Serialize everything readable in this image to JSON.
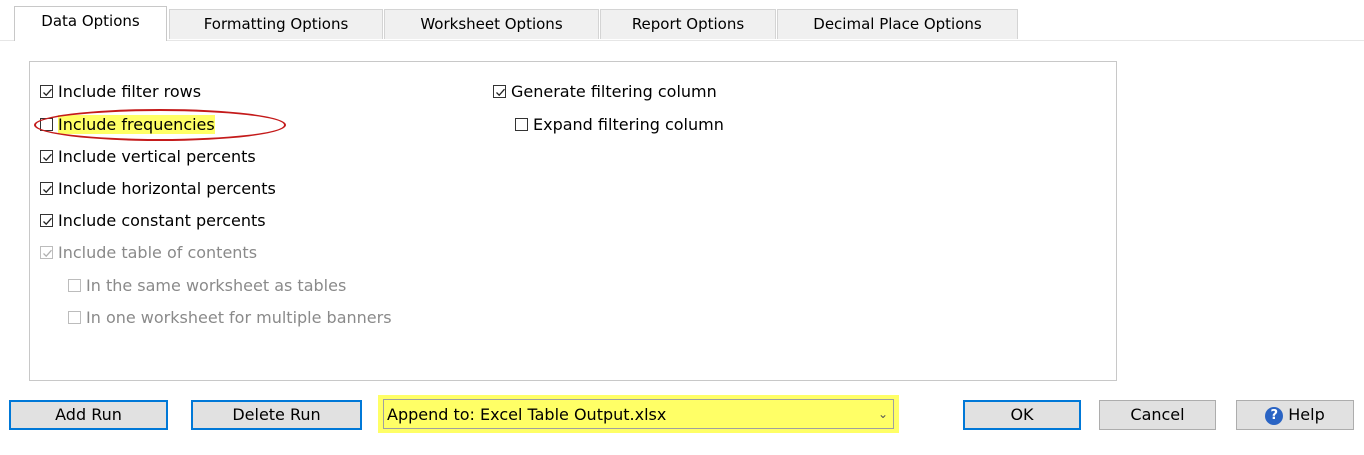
{
  "tabs": [
    {
      "label": "Data Options",
      "active": true
    },
    {
      "label": "Formatting Options",
      "active": false
    },
    {
      "label": "Worksheet Options",
      "active": false
    },
    {
      "label": "Report Options",
      "active": false
    },
    {
      "label": "Decimal Place Options",
      "active": false
    }
  ],
  "options_left": [
    {
      "label": "Include filter rows",
      "checked": true,
      "disabled": false
    },
    {
      "label": "Include frequencies",
      "checked": false,
      "disabled": false,
      "highlighted": true
    },
    {
      "label": "Include vertical percents",
      "checked": true,
      "disabled": false
    },
    {
      "label": "Include horizontal percents",
      "checked": true,
      "disabled": false
    },
    {
      "label": "Include constant percents",
      "checked": true,
      "disabled": false
    },
    {
      "label": "Include table of contents",
      "checked": true,
      "disabled": true
    },
    {
      "label": "In the same worksheet as tables",
      "checked": false,
      "disabled": true
    },
    {
      "label": "In one worksheet for multiple banners",
      "checked": false,
      "disabled": true
    }
  ],
  "options_right": [
    {
      "label": "Generate filtering column",
      "checked": true,
      "disabled": false
    },
    {
      "label": "Expand filtering column",
      "checked": false,
      "disabled": false
    }
  ],
  "buttons": {
    "add_run": "Add Run",
    "delete_run": "Delete Run",
    "ok": "OK",
    "cancel": "Cancel",
    "help": "Help"
  },
  "append_select": {
    "value": "Append to: Excel Table Output.xlsx"
  },
  "colors": {
    "highlight": "#ffff66",
    "annotation_ellipse": "#c41a1a",
    "focus": "#0078d7"
  }
}
